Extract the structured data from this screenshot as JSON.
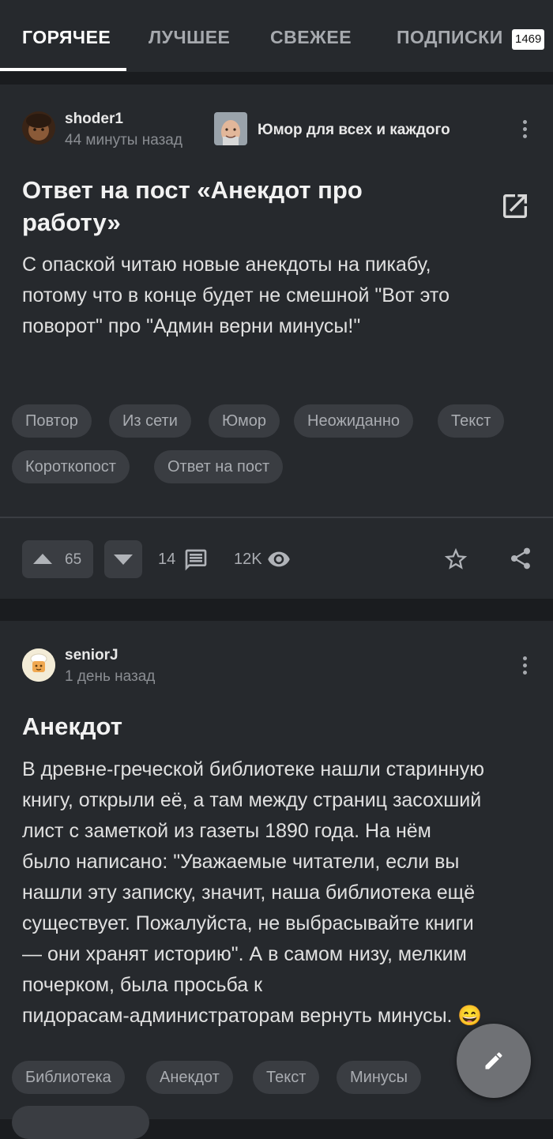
{
  "tabs": [
    {
      "label": "ГОРЯЧЕЕ"
    },
    {
      "label": "ЛУЧШЕЕ"
    },
    {
      "label": "СВЕЖЕЕ"
    },
    {
      "label": "ПОДПИСКИ"
    }
  ],
  "subscriptions_badge": "1469",
  "post1": {
    "author": "shoder1",
    "time": "44 минуты назад",
    "community": "Юмор для всех и каждого",
    "title_line1": "Ответ на пост «Анекдот про",
    "title_line2": "работу»",
    "body_lines": [
      "С опаской читаю новые анекдоты на пикабу,",
      "потому что в конце будет не смешной \"Вот это",
      "поворот\" про \"Админ верни минусы!\""
    ],
    "tags": [
      "Повтор",
      "Из сети",
      "Юмор",
      "Неожиданно",
      "Текст",
      "Короткопост",
      "Ответ на пост"
    ],
    "rating": "65",
    "comments": "14",
    "views": "12K"
  },
  "post2": {
    "author": "seniorJ",
    "time": "1 день назад",
    "title": "Анекдот",
    "body_lines": [
      "В древне-греческой библиотеке нашли старинную",
      "книгу, открыли её, а там между страниц засохший",
      "лист с заметкой из газеты 1890 года. На нём",
      "было написано: \"Уважаемые читатели, если вы",
      "нашли эту записку, значит, наша библиотека ещё",
      "существует. Пожалуйста, не выбрасывайте книги",
      "— они хранят историю\". А в самом низу, мелким",
      "почерком, была просьба к",
      "пидорасам-администраторам вернуть минусы. 😄"
    ],
    "tags": [
      "Библиотека",
      "Анекдот",
      "Текст",
      "Минусы"
    ]
  },
  "icons": {
    "open": "open-in-new-icon",
    "upvote": "arrow-up-icon",
    "downvote": "arrow-down-icon",
    "comments": "comment-icon",
    "views": "eye-icon",
    "favorite": "star-outline-icon",
    "share": "share-icon",
    "more": "more-vertical-icon",
    "fab": "pencil-icon"
  }
}
